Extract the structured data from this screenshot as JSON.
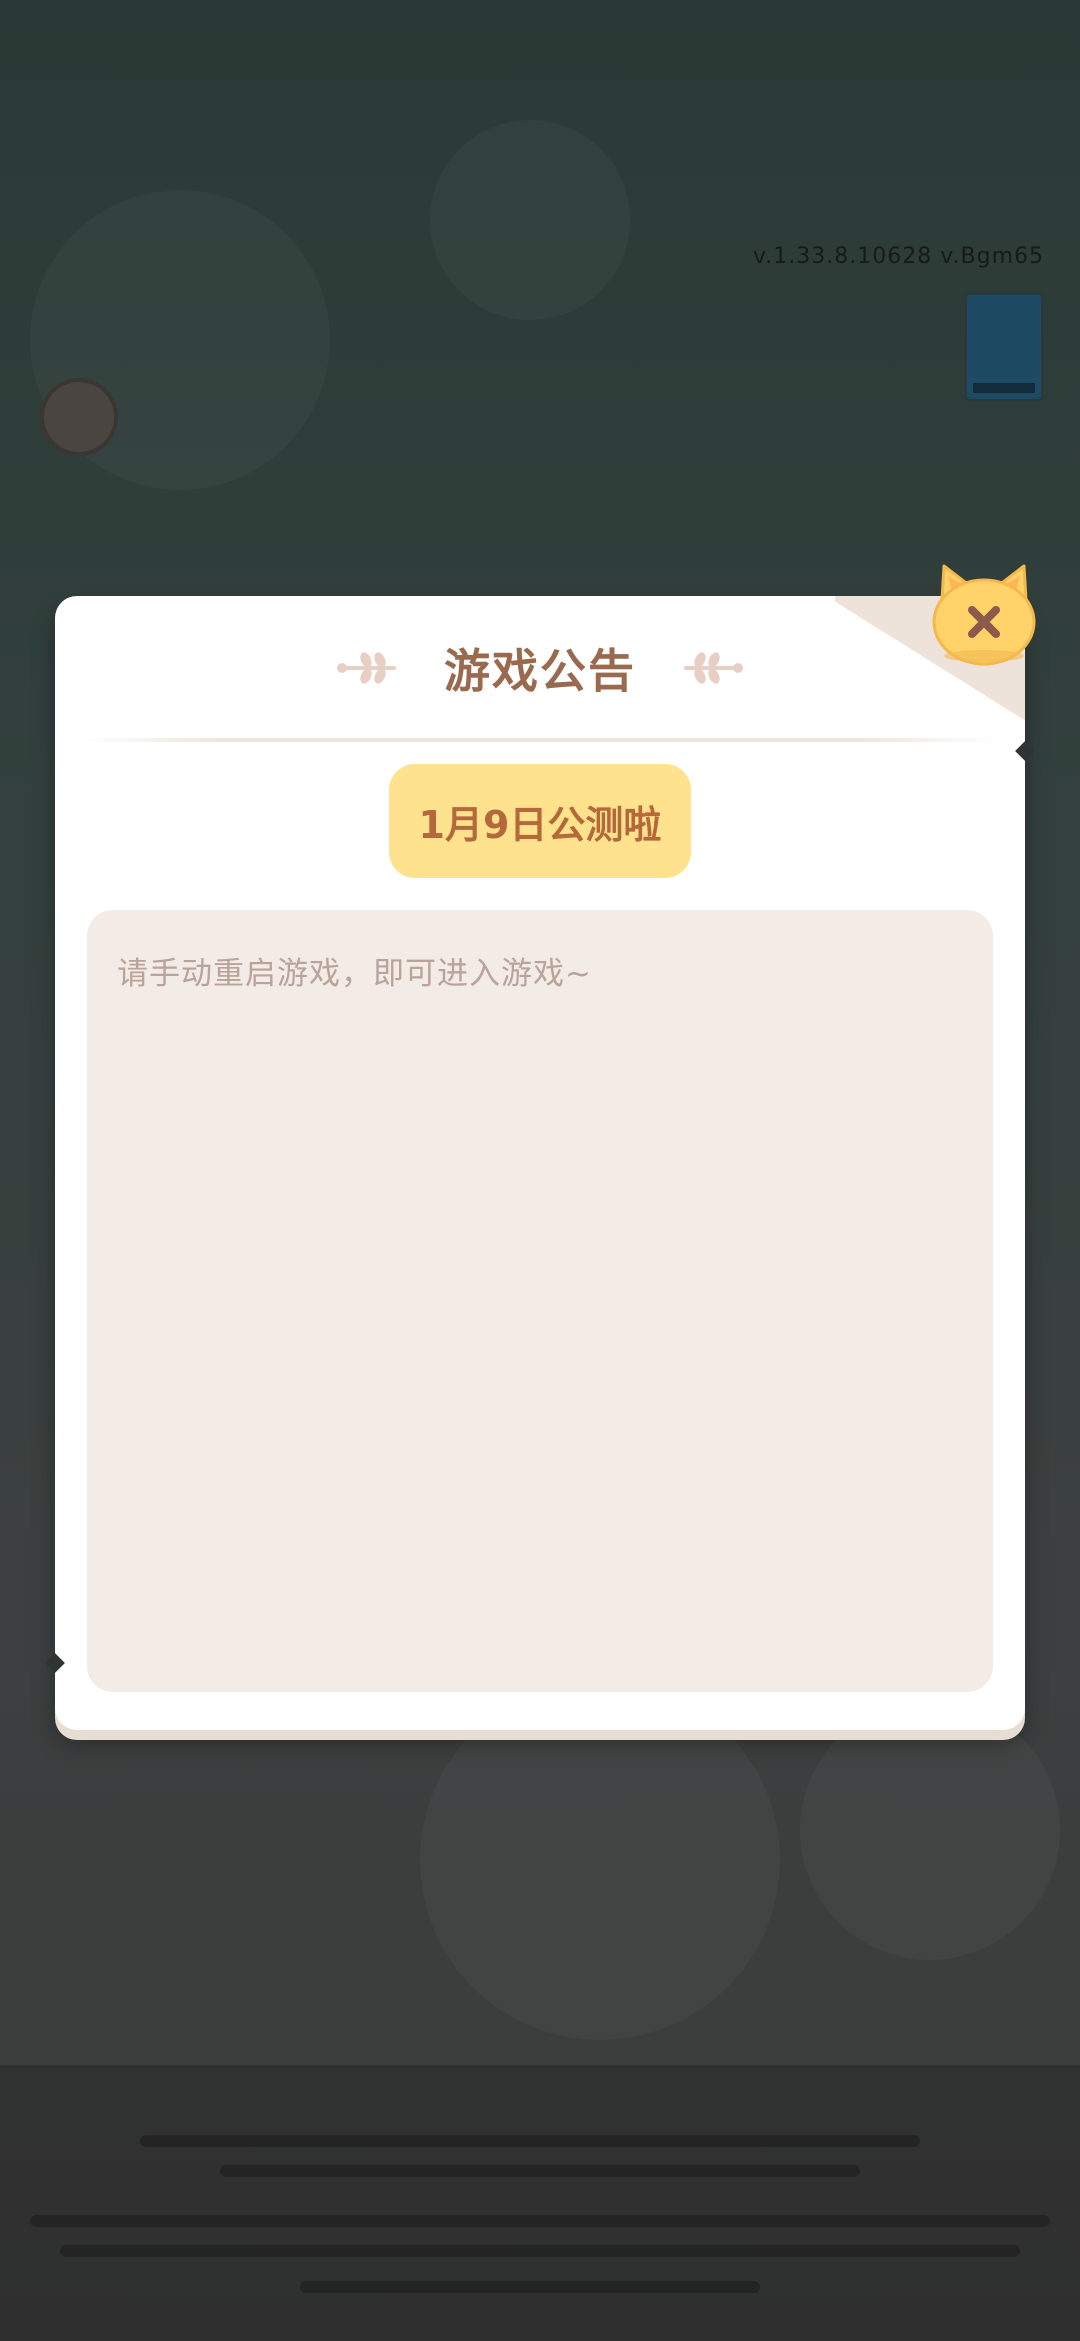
{
  "background": {
    "version_text": "v.1.33.8.10628 v.Bgm65"
  },
  "dialog": {
    "title": "游戏公告",
    "notice_tab": "1月9日公测啦",
    "content": "请手动重启游戏，即可进入游戏~"
  },
  "colors": {
    "title": "#9a6a4f",
    "pill_bg": "#ffe28e",
    "pill_text": "#b5693b",
    "content_bg": "#f2ebe6",
    "content_text": "#b9a39a",
    "close_bg": "#ffd36a"
  },
  "icons": {
    "close": "close-icon",
    "leaf_left": "leaf-ornament-left-icon",
    "leaf_right": "leaf-ornament-right-icon"
  }
}
